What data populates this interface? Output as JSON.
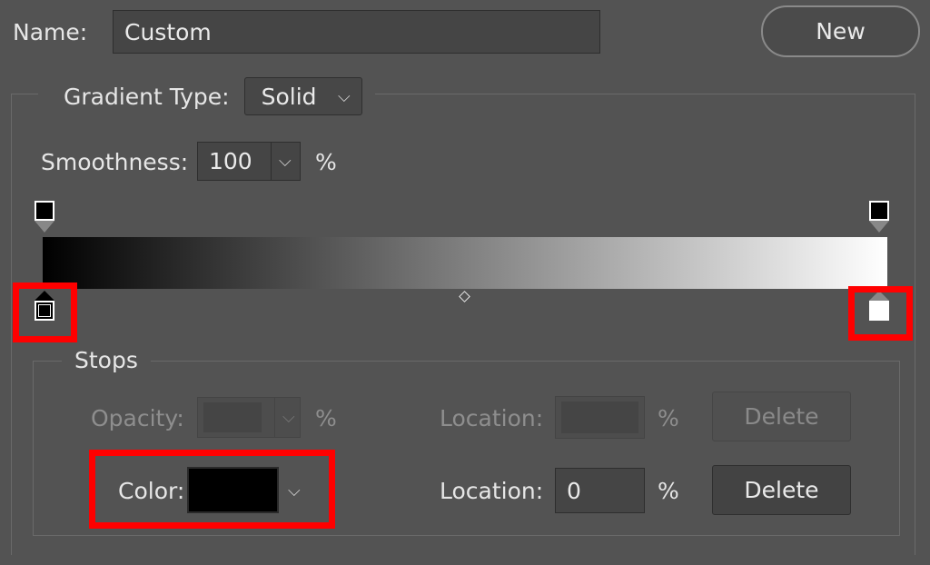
{
  "name_label": "Name:",
  "name_value": "Custom",
  "new_button": "New",
  "gradient_type_label": "Gradient Type:",
  "gradient_type_value": "Solid",
  "smoothness_label": "Smoothness:",
  "smoothness_value": "100",
  "percent": "%",
  "gradient": {
    "start_color": "#000000",
    "end_color": "#ffffff",
    "midpoint_percent": 50
  },
  "stops_group": {
    "title": "Stops",
    "opacity_label": "Opacity:",
    "opacity_value": "",
    "opacity_location_label": "Location:",
    "opacity_location_value": "",
    "opacity_delete": "Delete",
    "color_label": "Color:",
    "color_swatch": "#000000",
    "color_location_label": "Location:",
    "color_location_value": "0",
    "color_delete": "Delete"
  },
  "highlight_color": "#ff0000"
}
